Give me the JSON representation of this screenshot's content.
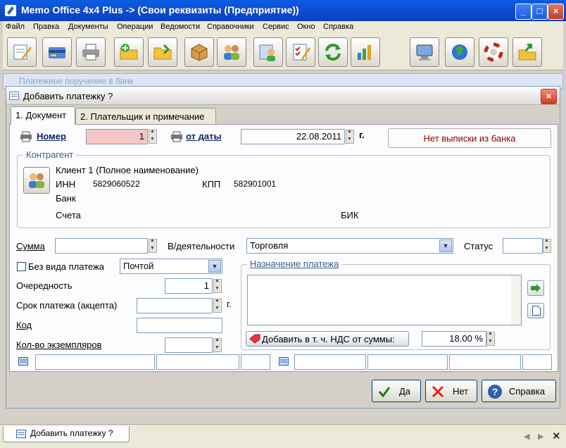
{
  "window": {
    "title": "Memo Office 4x4 Plus -> (Свои реквизиты (Предприятие))"
  },
  "menu": [
    "Файл",
    "Правка",
    "Документы",
    "Операции",
    "Ведомости",
    "Справочники",
    "Сервис",
    "Окно",
    "Справка"
  ],
  "background_window": {
    "title": "Платежное поручение в банк"
  },
  "dialog": {
    "title": "Добавить платежку ?",
    "tabs": [
      "1. Документ",
      "2. Плательщик и примечание"
    ],
    "number_label": "Номер",
    "number_value": "1",
    "date_label": "от даты",
    "date_value": "22.08.2011",
    "date_suffix": "г.",
    "bank_status": "Нет выписки из банка",
    "contragent": {
      "title": "Контрагент",
      "name": "Клиент 1 (Полное наименование)",
      "inn_label": "ИНН",
      "inn_value": "5829060522",
      "kpp_label": "КПП",
      "kpp_value": "582901001",
      "bank_label": "Банк",
      "accounts_label": "Счета",
      "bik_label": "БИК"
    },
    "sum_label": "Сумма",
    "activity_label": "В/деятельности",
    "activity_value": "Торговля",
    "status_label": "Статус",
    "no_payment_type_label": "Без вида платежа",
    "payment_method_value": "Почтой",
    "priority_label": "Очередность",
    "priority_value": "1",
    "deadline_label": "Срок платежа (акцепта)",
    "deadline_suffix": "г.",
    "code_label": "Код",
    "copies_label": "Кол-во экземпляров",
    "purpose_title": "Назначение платежа",
    "add_vat_label": "Добавить в т. ч. НДС от суммы:",
    "vat_value": "18.00 %",
    "buttons": {
      "yes": "Да",
      "no": "Нет",
      "help": "Справка"
    }
  },
  "status_tab": {
    "label": "Добавить платежку ?"
  },
  "colors": {
    "title_blue": "#0f4fd3",
    "number_bg": "#f4c6c6",
    "bank_status_text": "#8b0000"
  }
}
